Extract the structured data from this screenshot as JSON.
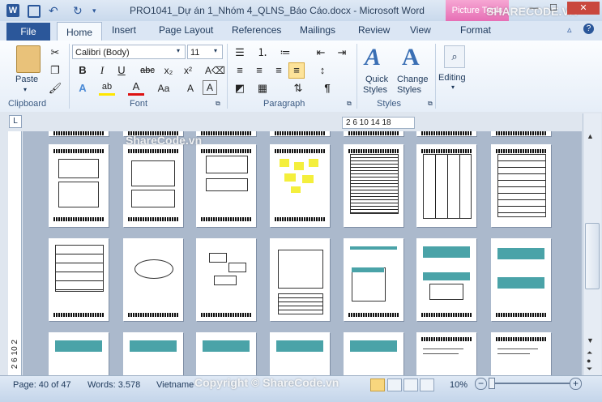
{
  "title_bar": {
    "app_icon": "word-icon",
    "title": "PRO1041_Dự án 1_Nhóm 4_QLNS_Báo Cáo.docx - Microsoft Word",
    "contextual_tab": "Picture Tools",
    "brand_logo": "SHARECODE.VN"
  },
  "tabs": {
    "file": "File",
    "items": [
      "Home",
      "Insert",
      "Page Layout",
      "References",
      "Mailings",
      "Review",
      "View",
      "Format"
    ]
  },
  "ribbon": {
    "clipboard": {
      "label": "Clipboard",
      "paste": "Paste"
    },
    "font": {
      "label": "Font",
      "font_name": "Calibri (Body)",
      "font_size": "11"
    },
    "paragraph": {
      "label": "Paragraph"
    },
    "styles": {
      "label": "Styles",
      "quick_styles_1": "Quick",
      "quick_styles_2": "Styles",
      "change_styles_1": "Change",
      "change_styles_2": "Styles"
    },
    "editing": {
      "label": "Editing"
    }
  },
  "ruler": {
    "marks": "2  6  10  14  18"
  },
  "vertical_ruler": {
    "marks": "2  6  10  2"
  },
  "watermarks": {
    "top": "ShareCode.vn",
    "bottom": "Copyright © ShareCode.vn"
  },
  "status_bar": {
    "page": "Page: 40 of 47",
    "words": "Words: 3.578",
    "language": "Vietname",
    "zoom": "10%",
    "zoom_level": 0.1
  },
  "colors": {
    "accent": "#2b579a",
    "contextual": "#e66fb5",
    "teal": "#4aa3a8"
  }
}
